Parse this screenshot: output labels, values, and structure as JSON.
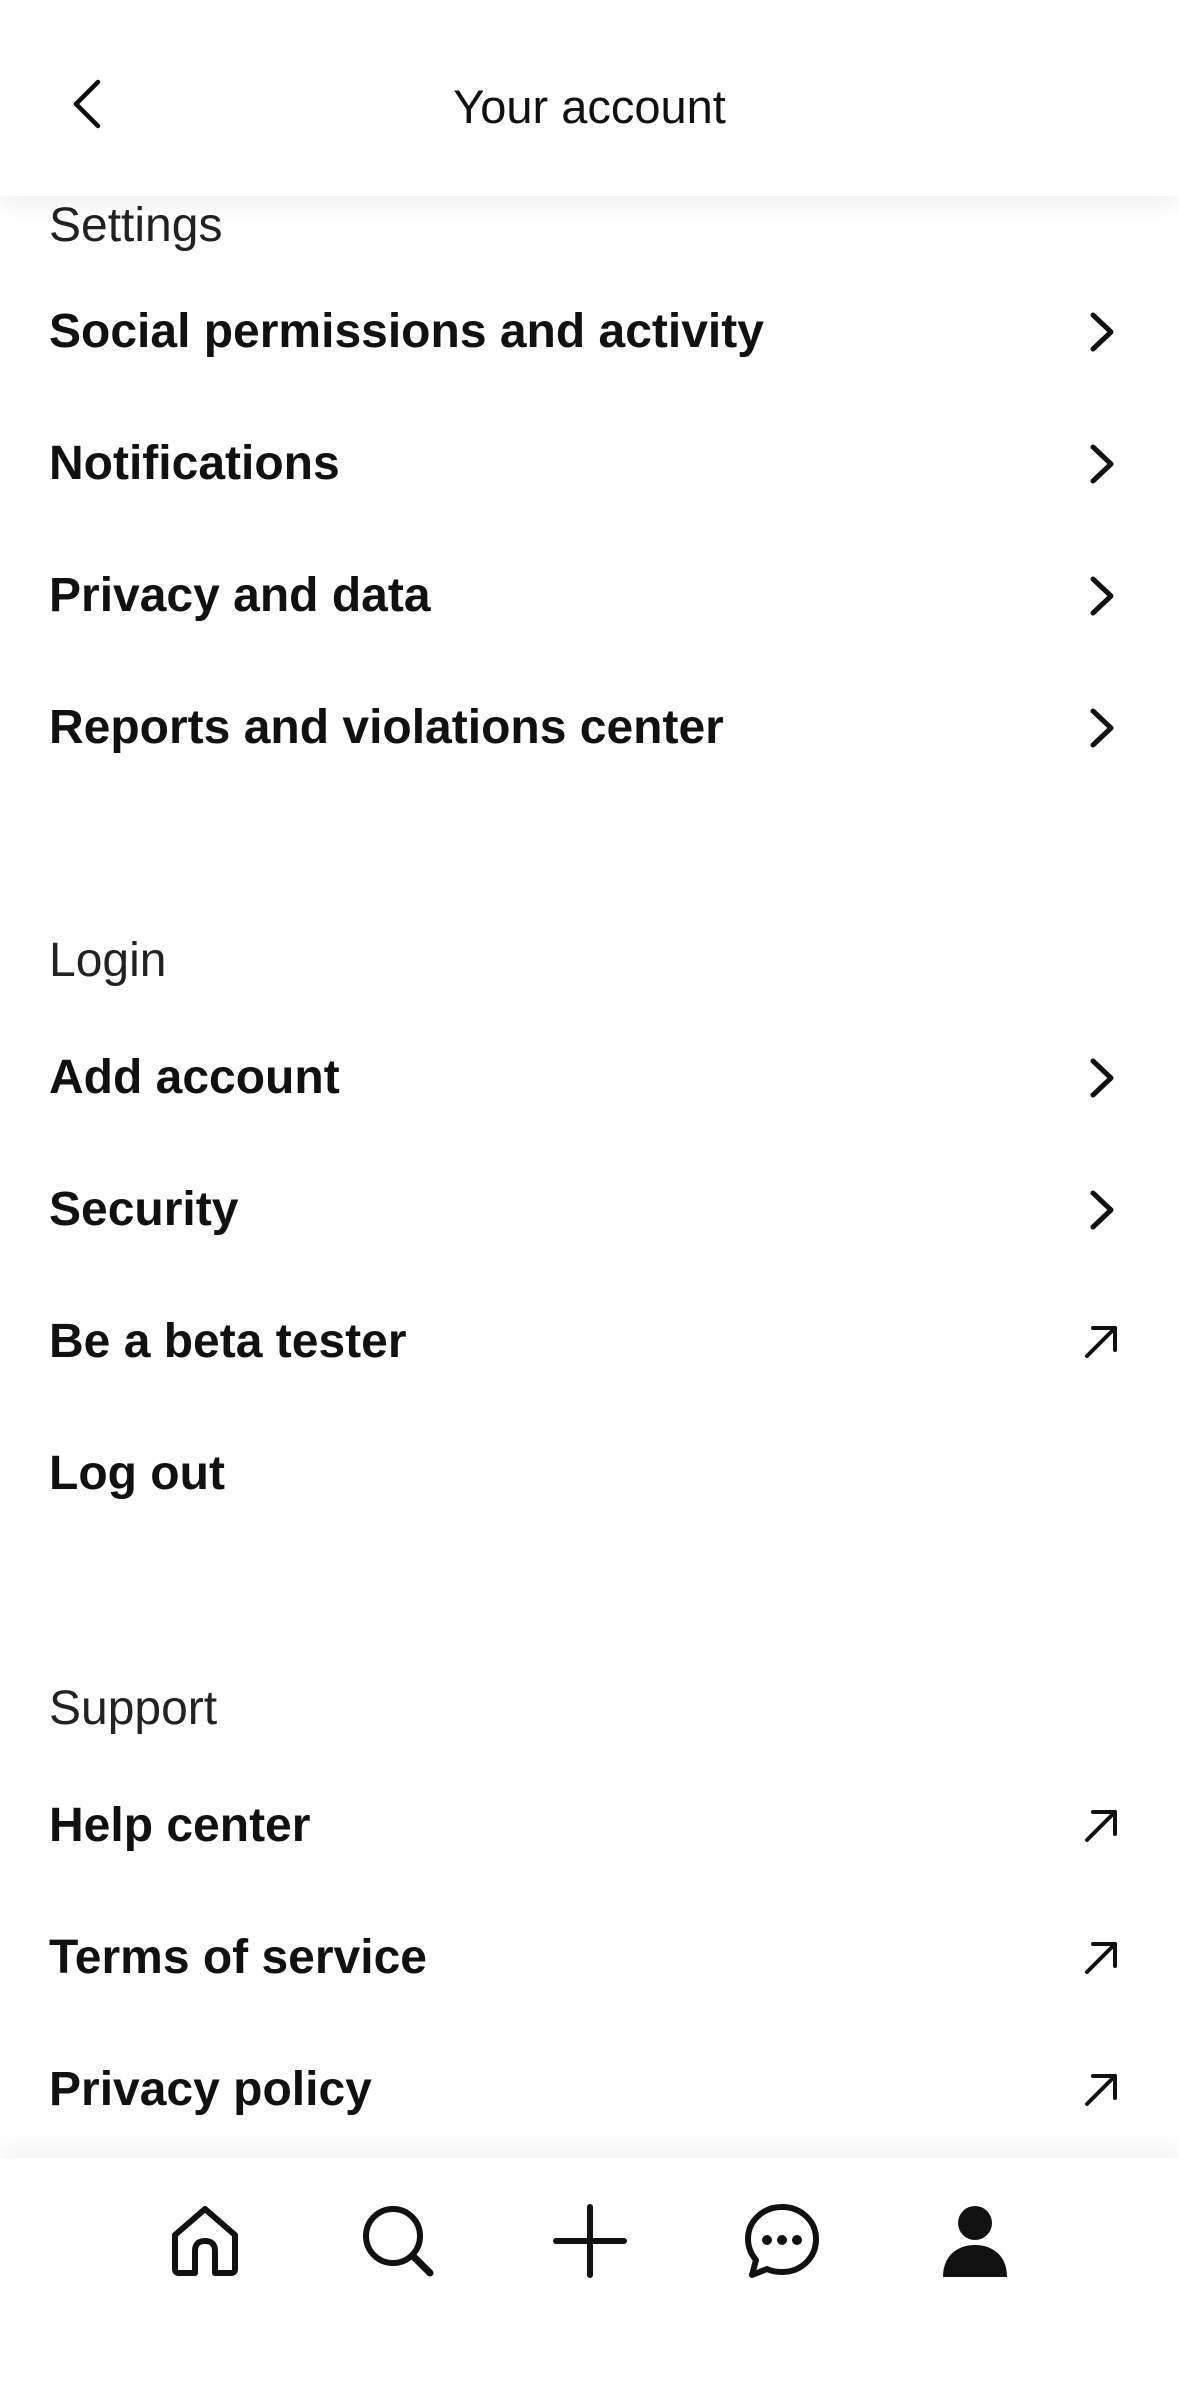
{
  "header": {
    "title": "Your account",
    "back_icon": "chevron-left-icon"
  },
  "sections": {
    "settings": {
      "title": "Settings",
      "items": [
        {
          "label": "Social permissions and activity",
          "icon": "chevron-right-icon"
        },
        {
          "label": "Notifications",
          "icon": "chevron-right-icon"
        },
        {
          "label": "Privacy and data",
          "icon": "chevron-right-icon"
        },
        {
          "label": "Reports and violations center",
          "icon": "chevron-right-icon"
        }
      ]
    },
    "login": {
      "title": "Login",
      "items": [
        {
          "label": "Add account",
          "icon": "chevron-right-icon"
        },
        {
          "label": "Security",
          "icon": "chevron-right-icon"
        },
        {
          "label": "Be a beta tester",
          "icon": "external-link-icon"
        },
        {
          "label": "Log out",
          "icon": ""
        }
      ]
    },
    "support": {
      "title": "Support",
      "items": [
        {
          "label": "Help center",
          "icon": "external-link-icon"
        },
        {
          "label": "Terms of service",
          "icon": "external-link-icon"
        },
        {
          "label": "Privacy policy",
          "icon": "external-link-icon"
        }
      ]
    }
  },
  "tabbar": {
    "items": [
      {
        "name": "home",
        "icon": "home-icon"
      },
      {
        "name": "search",
        "icon": "search-icon"
      },
      {
        "name": "create",
        "icon": "plus-icon"
      },
      {
        "name": "messages",
        "icon": "chat-icon"
      },
      {
        "name": "profile",
        "icon": "profile-icon",
        "active": true
      }
    ]
  },
  "colors": {
    "text": "#111111",
    "background": "#ffffff",
    "section_text": "#222222"
  }
}
